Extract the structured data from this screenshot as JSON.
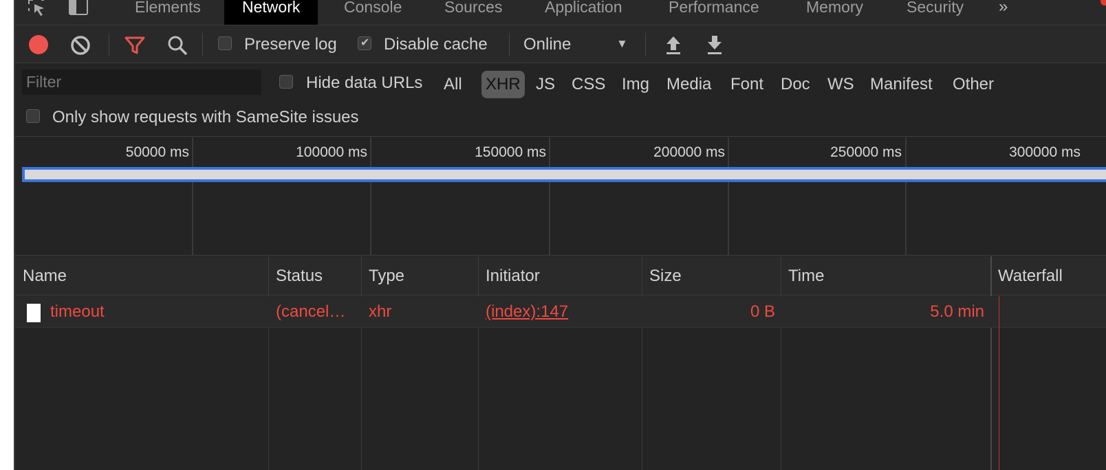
{
  "tabs": [
    {
      "label": "Elements",
      "active": false
    },
    {
      "label": "Network",
      "active": true
    },
    {
      "label": "Console",
      "active": false
    },
    {
      "label": "Sources",
      "active": false
    },
    {
      "label": "Application",
      "active": false
    },
    {
      "label": "Performance",
      "active": false
    },
    {
      "label": "Memory",
      "active": false
    },
    {
      "label": "Security",
      "active": false
    }
  ],
  "tab_overflow": "»",
  "toolbar": {
    "preserve_log_label": "Preserve log",
    "preserve_log_checked": false,
    "disable_cache_label": "Disable cache",
    "disable_cache_checked": true,
    "throttle_value": "Online",
    "caret": "▼",
    "icons": [
      "record-icon",
      "clear-icon",
      "filter-icon",
      "search-icon",
      "import-icon",
      "export-icon"
    ]
  },
  "filterbar": {
    "filter_placeholder": "Filter",
    "hide_data_urls_label": "Hide data URLs",
    "types": [
      "All",
      "XHR",
      "JS",
      "CSS",
      "Img",
      "Media",
      "Font",
      "Doc",
      "WS",
      "Manifest",
      "Other"
    ],
    "active_type": "XHR",
    "samesite_label": "Only show requests with SameSite issues"
  },
  "overview": {
    "ticks": [
      "50000 ms",
      "100000 ms",
      "150000 ms",
      "200000 ms",
      "250000 ms",
      "300000 ms"
    ]
  },
  "table": {
    "columns": [
      "Name",
      "Status",
      "Type",
      "Initiator",
      "Size",
      "Time",
      "Waterfall"
    ],
    "rows": [
      {
        "name": "timeout",
        "status": "(cancel…",
        "type": "xhr",
        "initiator": "(index):147",
        "size": "0 B",
        "time": "5.0 min"
      }
    ]
  },
  "colors": {
    "error_text": "#ee4a40",
    "record": "#ef5350",
    "filter_icon": "#e8534a",
    "selection_blue": "#3b74d8"
  }
}
